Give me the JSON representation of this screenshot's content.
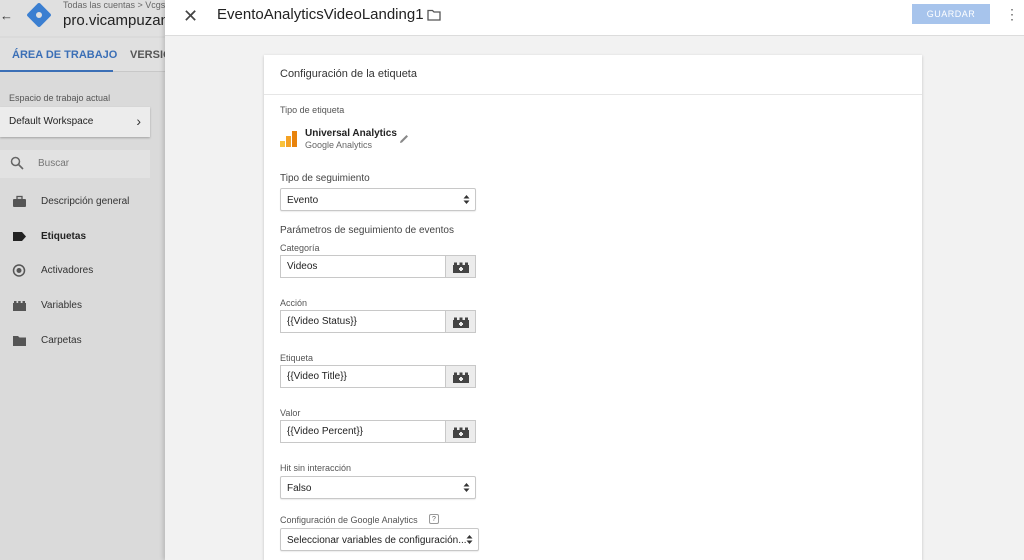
{
  "left_panel": {
    "back_glyph": "←",
    "breadcrumb": "Todas las cuentas  >  Vcgs",
    "container_name": "pro.vicampuzan",
    "tabs": [
      "ÁREA DE TRABAJO",
      "VERSIO"
    ],
    "workspace_label": "Espacio de trabajo actual",
    "workspace_name": "Default Workspace",
    "search_placeholder": "Buscar",
    "nav": [
      {
        "label": "Descripción general",
        "icon": "briefcase-icon"
      },
      {
        "label": "Etiquetas",
        "icon": "tag-icon",
        "active": true
      },
      {
        "label": "Activadores",
        "icon": "trigger-icon"
      },
      {
        "label": "Variables",
        "icon": "blocks-icon"
      },
      {
        "label": "Carpetas",
        "icon": "folder-icon"
      }
    ]
  },
  "header": {
    "close_glyph": "✕",
    "title": "EventoAnalyticsVideoLanding1",
    "save_label": "GUARDAR",
    "more_glyph": "⋮"
  },
  "card": {
    "title": "Configuración de la etiqueta",
    "tag_type_label": "Tipo de etiqueta",
    "tag_type_name": "Universal Analytics",
    "tag_type_sub": "Google Analytics",
    "tracking_type_label": "Tipo de seguimiento",
    "tracking_type_value": "Evento",
    "event_params_title": "Parámetros de seguimiento de eventos",
    "fields": [
      {
        "label": "Categoría",
        "value": "Videos"
      },
      {
        "label": "Acción",
        "value": "{{Video Status}}"
      },
      {
        "label": "Etiqueta",
        "value": "{{Video Title}}"
      },
      {
        "label": "Valor",
        "value": "{{Video Percent}}"
      }
    ],
    "non_interaction_label": "Hit sin interacción",
    "non_interaction_value": "Falso",
    "ga_settings_label": "Configuración de Google Analytics",
    "ga_settings_help": "?",
    "ga_settings_value": "Seleccionar variables de configuración..."
  },
  "colors": {
    "accent": "#3b6fb6",
    "save_disabled": "#a7c4ec",
    "logo": "#3b7fd1",
    "ua_orange": "#f4a224"
  }
}
